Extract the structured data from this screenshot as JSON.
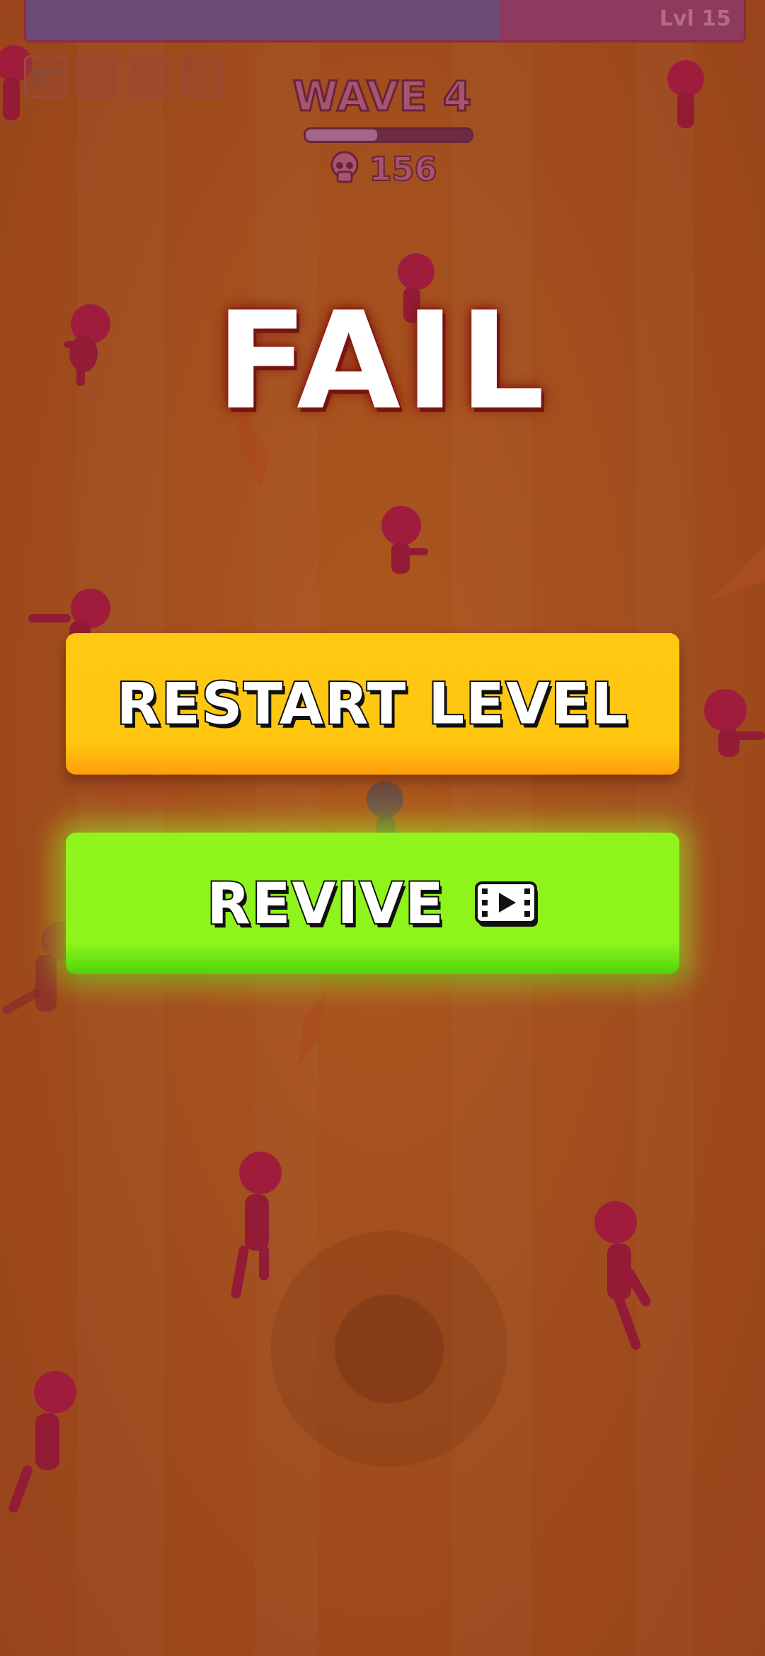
{
  "hud": {
    "level_label": "Lvl 15",
    "level_progress": 0.66,
    "weapon_slots": [
      {
        "icon": "pistol-icon",
        "filled": true
      },
      {
        "icon": "empty-slot",
        "filled": false
      },
      {
        "icon": "empty-slot",
        "filled": false
      },
      {
        "icon": "empty-slot",
        "filled": false
      }
    ],
    "wave_label": "WAVE 4",
    "wave_progress": 0.43,
    "kill_count": "156",
    "kill_icon": "skull-icon"
  },
  "result": {
    "title": "FAIL"
  },
  "buttons": {
    "restart_label": "RESTART LEVEL",
    "revive_label": "REVIVE",
    "revive_icon": "video-ad-icon"
  },
  "colors": {
    "background": "#b45a1f",
    "restart_button": "#ffc610",
    "revive_button": "#8ef41b",
    "enemy": "#b0144a"
  }
}
